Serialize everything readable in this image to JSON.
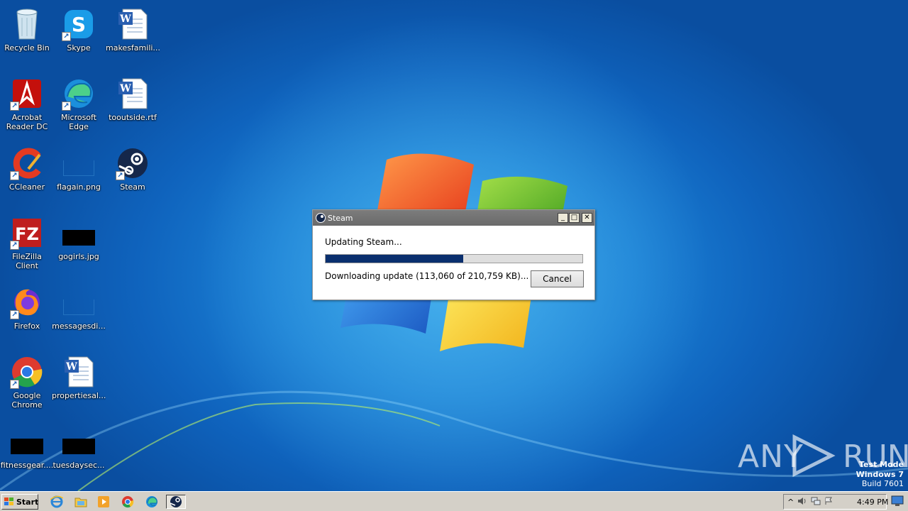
{
  "desktop": {
    "icons": [
      {
        "label": "Recycle Bin",
        "icon": "recycle-bin-icon"
      },
      {
        "label": "Skype",
        "icon": "skype-icon"
      },
      {
        "label": "makesfamili...",
        "icon": "word-document-icon"
      },
      {
        "label": "Acrobat Reader DC",
        "icon": "acrobat-icon"
      },
      {
        "label": "Microsoft Edge",
        "icon": "edge-icon"
      },
      {
        "label": "tooutside.rtf",
        "icon": "word-document-icon"
      },
      {
        "label": "CCleaner",
        "icon": "ccleaner-icon"
      },
      {
        "label": "flagain.png",
        "icon": "image-file-icon"
      },
      {
        "label": "Steam",
        "icon": "steam-icon"
      },
      {
        "label": "FileZilla Client",
        "icon": "filezilla-icon"
      },
      {
        "label": "gogirls.jpg",
        "icon": "image-file-icon"
      },
      {
        "label": "Firefox",
        "icon": "firefox-icon"
      },
      {
        "label": "messagesdi...",
        "icon": "image-file-icon"
      },
      {
        "label": "Google Chrome",
        "icon": "chrome-icon"
      },
      {
        "label": "propertiesal...",
        "icon": "word-document-icon"
      },
      {
        "label": "fitnessgear....",
        "icon": "image-file-icon"
      },
      {
        "label": "tuesdaysec...",
        "icon": "image-file-icon"
      }
    ]
  },
  "steam_dialog": {
    "title": "Steam",
    "status": "Updating Steam...",
    "detail": "Downloading update (113,060 of 210,759 KB)...",
    "progress": 0.536,
    "cancel_label": "Cancel",
    "min_symbol": "_",
    "max_symbol": "□",
    "close_symbol": "✕"
  },
  "watermark": {
    "left": "ANY",
    "right": "RUN"
  },
  "os_info": {
    "line1": "Test Mode",
    "line2": "Windows 7",
    "line3": "Build 7601"
  },
  "taskbar": {
    "start_label": "Start",
    "pinned": [
      "ie-icon",
      "explorer-icon",
      "media-player-icon",
      "chrome-icon",
      "edge-icon",
      "steam-icon"
    ],
    "clock": "4:49 PM",
    "tray_up": "^"
  },
  "colors": {
    "progress": "#0a2f6e",
    "desktop": "#1a7fd4",
    "taskbar": "#d4d0c8"
  }
}
